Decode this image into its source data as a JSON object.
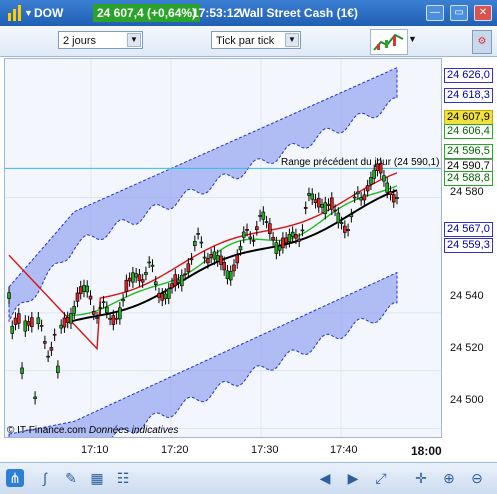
{
  "titlebar": {
    "symbol": "DOW",
    "price_badge": "24 607,4 (+0,64%)",
    "time": "17:53:12",
    "instrument": "Wall Street Cash (1€)",
    "badge_color": "#29a329"
  },
  "toolbar": {
    "period_select": "2 jours",
    "tick_select": "Tick par tick"
  },
  "chart": {
    "reference_label": "Range précédent du jour (24 590,1)",
    "watermark": "© IT-Finance.com",
    "watermark_note": "Données indicatives",
    "y_ticks": [
      "24 580",
      "24 540",
      "24 520",
      "24 500"
    ],
    "y_badges": [
      {
        "label": "24 626,0",
        "color": "#0000aa",
        "bg": "#ffffff",
        "border": "#3333cc"
      },
      {
        "label": "24 618,3",
        "color": "#0000aa",
        "bg": "#ffffff",
        "border": "#3333cc"
      },
      {
        "label": "24 607,9",
        "color": "#000000",
        "bg": "#f0e040",
        "border": "#c8a800"
      },
      {
        "label": "24 606,4",
        "color": "#006600",
        "bg": "#ffffff",
        "border": "#22aa22"
      },
      {
        "label": "24 596,5",
        "color": "#006600",
        "bg": "#ffffff",
        "border": "#22aa22"
      },
      {
        "label": "24 590,7",
        "color": "#000000",
        "bg": "#ffffff",
        "border": "#888888"
      },
      {
        "label": "24 588,8",
        "color": "#006600",
        "bg": "#ffffff",
        "border": "#22aa22"
      },
      {
        "label": "24 567,0",
        "color": "#0000aa",
        "bg": "#ffffff",
        "border": "#3333cc"
      },
      {
        "label": "24 559,3",
        "color": "#0000aa",
        "bg": "#ffffff",
        "border": "#3333cc"
      }
    ],
    "x_ticks": [
      "17:10",
      "17:20",
      "17:30",
      "17:40",
      "18:00"
    ]
  },
  "chart_data": {
    "type": "candlestick",
    "xlabel": "",
    "ylabel": "",
    "ylim": [
      24497,
      24628
    ],
    "x_ticks": [
      "17:10",
      "17:20",
      "17:30",
      "17:40",
      "18:00"
    ],
    "reference_line": {
      "label": "Range précédent du jour (24 590,1)",
      "value": 24590.1
    },
    "colors": {
      "up": "#22aa22",
      "down": "#dd2222",
      "bands": "#8c9cf0",
      "ma_black": "#000000",
      "ma_green": "#22bb22",
      "ma_red": "#dd1111"
    }
  },
  "bottombar": {
    "icons": [
      "share-icon",
      "indicator-icon",
      "drawing-icon",
      "grid-icon",
      "table-icon",
      "arrow-left-icon",
      "arrow-right-icon",
      "fit-icon",
      "cursor-icon",
      "zoom-in-icon",
      "zoom-out-icon"
    ]
  }
}
